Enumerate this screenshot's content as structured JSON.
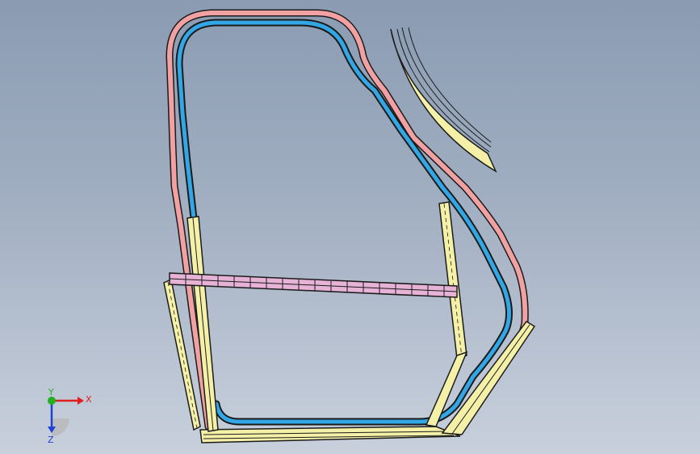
{
  "viewport": {
    "background_top": "#8a9bb2",
    "background_bottom": "#c8d0dc"
  },
  "colors": {
    "outer_seal": "#f2a1a3",
    "inner_tube": "#33a7e6",
    "brace": "#f4f0a8",
    "crossbar": "#e6b2d6",
    "edge": "#1b1b1b"
  },
  "triad": {
    "x_label": "X",
    "y_label": "Y",
    "z_label": "Z",
    "x_color": "#e02020",
    "y_color": "#20b020",
    "z_color": "#2040d8"
  }
}
